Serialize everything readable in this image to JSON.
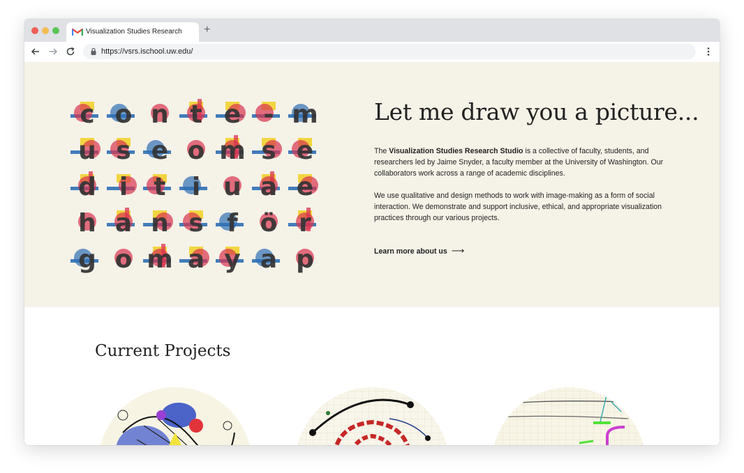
{
  "browser": {
    "tab_title": "Visualization Studies Research",
    "new_tab_label": "+",
    "url": "https://vsrs.ischool.uw.edu/"
  },
  "hero": {
    "letter_grid": [
      [
        "c",
        "o",
        "n",
        "t",
        "e",
        "-",
        "m"
      ],
      [
        "u",
        "s",
        "e",
        "o",
        "m",
        "s",
        "e"
      ],
      [
        "d",
        "i",
        "t",
        "i",
        "u",
        "a",
        "e"
      ],
      [
        "h",
        "a",
        "n",
        "s",
        "f",
        "ö",
        "r"
      ],
      [
        "g",
        "o",
        "m",
        "a",
        "y",
        "a",
        "p"
      ]
    ],
    "title": "Let me draw you a picture...",
    "intro_prefix": "The ",
    "intro_bold": "Visualization Studies Research Studio",
    "intro_suffix": " is a collective of faculty, students, and researchers led by Jaime Snyder, a faculty member at the University of Washington. Our collaborators work across a range of academic disciplines.",
    "paragraph2": "We use qualitative and design methods to work with image-making as a form of social interaction. We demonstrate and support inclusive, ethical, and appropriate visualization practices through our various projects.",
    "learn_more": "Learn more about us",
    "arrow": "⟶"
  },
  "projects": {
    "title": "Current Projects"
  },
  "colors": {
    "hero_bg": "#f5f2e8",
    "grid_blue": "#2f6fb5",
    "grid_red": "#d9334f",
    "grid_yellow": "#f2d22e",
    "letter_ink": "#333333"
  }
}
